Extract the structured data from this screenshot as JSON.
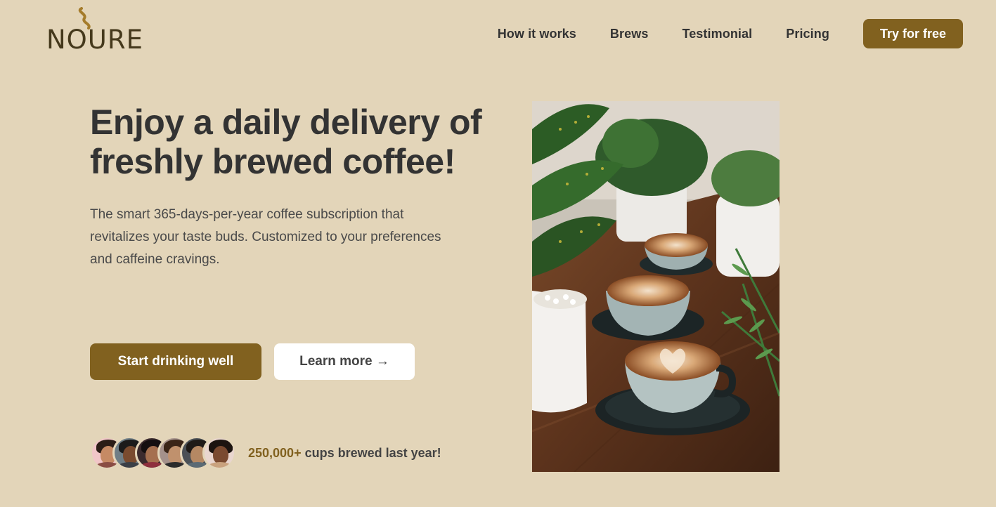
{
  "brand": {
    "name": "NOURE",
    "logo_icon": "steam-icon"
  },
  "nav": {
    "links": [
      "How it works",
      "Brews",
      "Testimonial",
      "Pricing"
    ],
    "cta": "Try for free"
  },
  "hero": {
    "title": "Enjoy a daily delivery of freshly brewed coffee!",
    "description": "The smart 365-days-per-year coffee subscription that revitalizes your taste buds. Customized to your preferences and caffeine cravings.",
    "primary_button": "Start drinking well",
    "secondary_button": "Learn more →",
    "image": "coffee-cups-with-plants-photo"
  },
  "social_proof": {
    "avatar_count": 6,
    "count": "250,000+",
    "text": "cups brewed last year!"
  },
  "colors": {
    "background": "#e3d5b9",
    "accent": "#81611f",
    "text": "#333333",
    "logo": "#45391c"
  }
}
